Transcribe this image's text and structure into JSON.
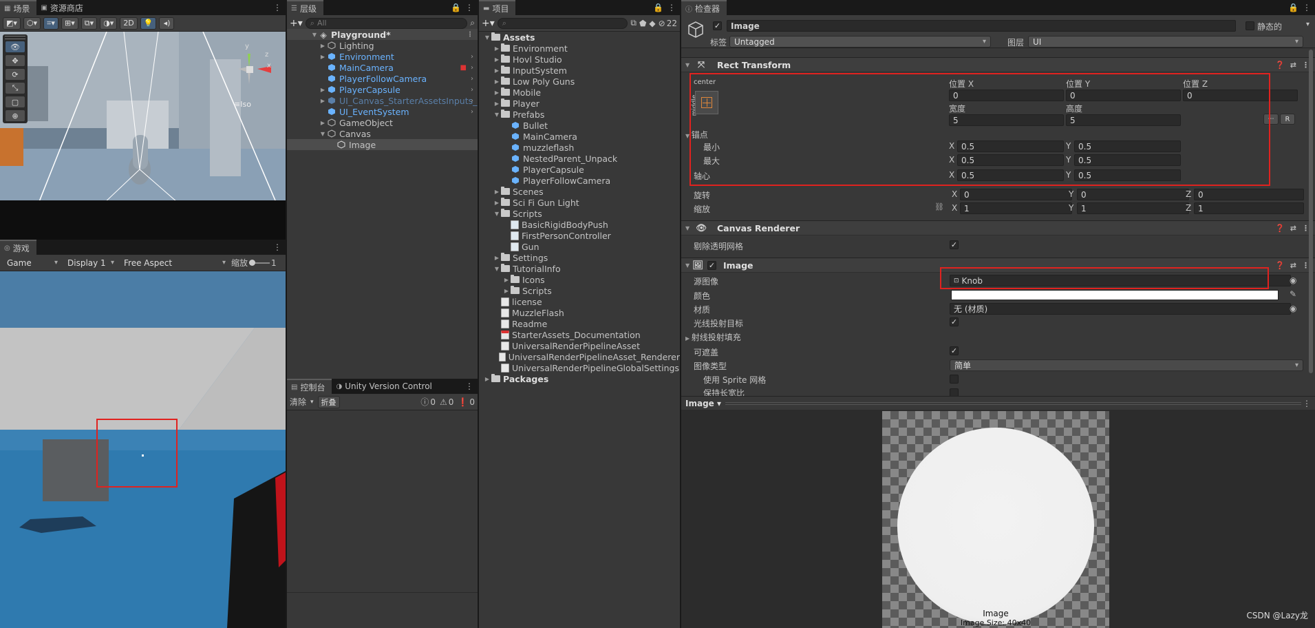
{
  "scene": {
    "tab_scene": "场景",
    "tab_store": "资源商店",
    "btn_2d": "2D",
    "gizmo_label": "≡Iso",
    "axis_y": "y",
    "axis_x": "x",
    "axis_z": "z"
  },
  "game": {
    "tab_game": "游戏",
    "game_dropdown": "Game",
    "display_dropdown": "Display 1",
    "aspect_dropdown": "Free Aspect",
    "scale_label": "缩放",
    "scale_value": "1"
  },
  "hierarchy": {
    "tab": "层级",
    "search_placeholder": "All",
    "root": "Playground*",
    "items": [
      {
        "label": "Lighting",
        "style": "normal"
      },
      {
        "label": "Environment",
        "style": "blue"
      },
      {
        "label": "MainCamera",
        "style": "blue"
      },
      {
        "label": "PlayerFollowCamera",
        "style": "blue"
      },
      {
        "label": "PlayerCapsule",
        "style": "blue"
      },
      {
        "label": "UI_Canvas_StarterAssetsInputs_",
        "style": "dim"
      },
      {
        "label": "UI_EventSystem",
        "style": "blue"
      },
      {
        "label": "GameObject",
        "style": "normal"
      },
      {
        "label": "Canvas",
        "style": "normal"
      },
      {
        "label": "Image",
        "style": "selected"
      }
    ]
  },
  "console": {
    "tab_console": "控制台",
    "tab_uvc": "Unity Version Control",
    "clear": "清除",
    "collapse": "折叠",
    "count_log": "0",
    "count_warn": "0",
    "count_err": "0"
  },
  "project": {
    "tab": "项目",
    "hidden_count": "22",
    "items": [
      {
        "label": "Assets",
        "bold": true
      },
      {
        "label": "Environment"
      },
      {
        "label": "Hovl Studio"
      },
      {
        "label": "InputSystem"
      },
      {
        "label": "Low Poly Guns"
      },
      {
        "label": "Mobile"
      },
      {
        "label": "Player"
      },
      {
        "label": "Prefabs"
      },
      {
        "label": "Bullet"
      },
      {
        "label": "MainCamera"
      },
      {
        "label": "muzzleflash"
      },
      {
        "label": "NestedParent_Unpack"
      },
      {
        "label": "PlayerCapsule"
      },
      {
        "label": "PlayerFollowCamera"
      },
      {
        "label": "Scenes"
      },
      {
        "label": "Sci Fi Gun Light"
      },
      {
        "label": "Scripts"
      },
      {
        "label": "BasicRigidBodyPush"
      },
      {
        "label": "FirstPersonController"
      },
      {
        "label": "Gun"
      },
      {
        "label": "Settings"
      },
      {
        "label": "TutorialInfo"
      },
      {
        "label": "Icons"
      },
      {
        "label": "Scripts"
      },
      {
        "label": "license"
      },
      {
        "label": "MuzzleFlash"
      },
      {
        "label": "Readme"
      },
      {
        "label": "StarterAssets_Documentation"
      },
      {
        "label": "UniversalRenderPipelineAsset"
      },
      {
        "label": "UniversalRenderPipelineAsset_Renderer"
      },
      {
        "label": "UniversalRenderPipelineGlobalSettings"
      },
      {
        "label": "Packages",
        "bold": true
      }
    ]
  },
  "inspector": {
    "tab": "检查器",
    "object_name": "Image",
    "static_label": "静态的",
    "tag_label": "标签",
    "tag_value": "Untagged",
    "layer_label": "图层",
    "layer_value": "UI",
    "rect": {
      "title": "Rect Transform",
      "anchor_preset_top": "center",
      "anchor_preset_side": "middle",
      "pos_x_label": "位置 X",
      "pos_y_label": "位置 Y",
      "pos_z_label": "位置 Z",
      "pos_x": "0",
      "pos_y": "0",
      "pos_z": "0",
      "width_label": "宽度",
      "height_label": "高度",
      "width": "5",
      "height": "5",
      "raw_btn": "R",
      "anchors_label": "锚点",
      "min_label": "最小",
      "max_label": "最大",
      "pivot_label": "轴心",
      "min_x": "0.5",
      "min_y": "0.5",
      "max_x": "0.5",
      "max_y": "0.5",
      "pivot_x": "0.5",
      "pivot_y": "0.5",
      "rotation_label": "旋转",
      "scale_label": "缩放",
      "rot_x": "0",
      "rot_y": "0",
      "rot_z": "0",
      "scale_x": "1",
      "scale_y": "1",
      "scale_z": "1",
      "x": "X",
      "y": "Y",
      "z": "Z"
    },
    "canvas_renderer": {
      "title": "Canvas Renderer",
      "cull_label": "剔除透明网格"
    },
    "image": {
      "title": "Image",
      "source_label": "源图像",
      "source_value": "Knob",
      "color_label": "颜色",
      "material_label": "材质",
      "material_value": "无 (材质)",
      "raycast_label": "光线投射目标",
      "padding_label": "射线投射填充",
      "maskable_label": "可遮盖",
      "type_label": "图像类型",
      "type_value": "简单",
      "sprite_mesh_label": "使用 Sprite 网格",
      "preserve_label": "保持长宽比"
    },
    "preview": {
      "dropdown": "Image",
      "name": "Image",
      "size": "Image Size: 40x40"
    }
  },
  "watermark": "CSDN @Lazy龙",
  "colors": {
    "accent_red": "#e0221f",
    "link_blue": "#6ab3ff",
    "selection": "#4d4d4d"
  }
}
